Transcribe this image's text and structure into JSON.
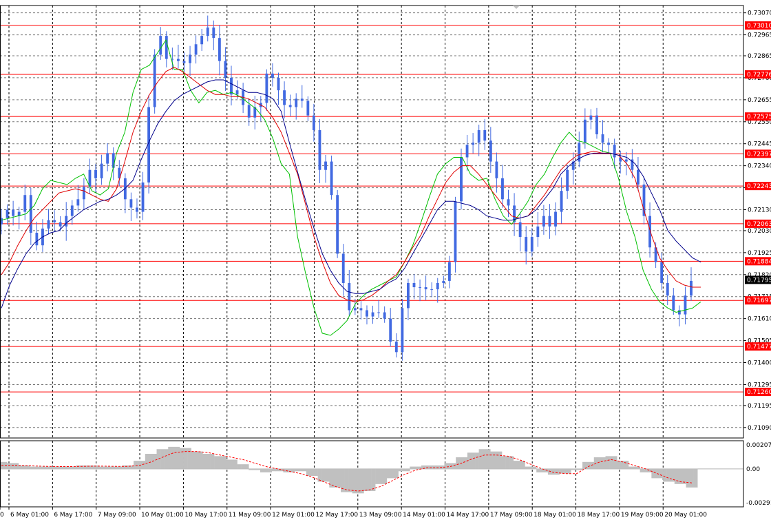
{
  "chart_data": {
    "type": "candlestick",
    "y_axis": {
      "range": [
        0.7104,
        0.73105
      ],
      "tick_labels": [
        "0.73070",
        "0.72965",
        "0.72865",
        "0.72760",
        "0.72655",
        "0.72550",
        "0.72445",
        "0.72340",
        "0.72235",
        "0.72130",
        "0.72030",
        "0.71925",
        "0.71820",
        "0.71715",
        "0.71610",
        "0.71505",
        "0.71400",
        "0.71295",
        "0.71195",
        "0.71090"
      ]
    },
    "x_axis": {
      "tick_labels": [
        "0",
        "6 May 01:00",
        "6 May 17:00",
        "7 May 09:00",
        "10 May 01:00",
        "10 May 17:00",
        "11 May 09:00",
        "12 May 01:00",
        "12 May 17:00",
        "13 May 09:00",
        "14 May 01:00",
        "14 May 17:00",
        "17 May 09:00",
        "18 May 01:00",
        "18 May 17:00",
        "19 May 09:00",
        "20 May 01:00"
      ]
    },
    "grid": true,
    "support_resistance_levels": [
      "0.73010",
      "0.72776",
      "0.72575",
      "0.72397",
      "0.72243",
      "0.72063",
      "0.71884",
      "0.71697",
      "0.71477",
      "0.71260"
    ],
    "current_price": "0.71795",
    "price_closes": [
      0.7209,
      0.7213,
      0.721,
      0.7212,
      0.722,
      0.7202,
      0.7196,
      0.7204,
      0.7208,
      0.7207,
      0.7205,
      0.721,
      0.7215,
      0.7218,
      0.7224,
      0.7232,
      0.7228,
      0.7235,
      0.724,
      0.7233,
      0.7228,
      0.7218,
      0.7214,
      0.7212,
      0.7226,
      0.7262,
      0.7287,
      0.7296,
      0.7285,
      0.7285,
      0.7284,
      0.7283,
      0.7287,
      0.7292,
      0.7296,
      0.73,
      0.7295,
      0.7284,
      0.7276,
      0.7268,
      0.727,
      0.7263,
      0.7257,
      0.7262,
      0.7264,
      0.7278,
      0.7276,
      0.727,
      0.7263,
      0.7262,
      0.7266,
      0.7265,
      0.7258,
      0.7251,
      0.7232,
      0.7236,
      0.722,
      0.7192,
      0.7178,
      0.7165,
      0.7166,
      0.7165,
      0.7162,
      0.7164,
      0.7164,
      0.7161,
      0.715,
      0.7145,
      0.7166,
      0.7178,
      0.7176,
      0.7176,
      0.7175,
      0.7175,
      0.7178,
      0.7179,
      0.7188,
      0.7217,
      0.7238,
      0.7244,
      0.7245,
      0.7251,
      0.7246,
      0.7236,
      0.7228,
      0.7218,
      0.7215,
      0.7207,
      0.72,
      0.7193,
      0.72,
      0.7205,
      0.721,
      0.7205,
      0.7212,
      0.7222,
      0.7232,
      0.7236,
      0.7245,
      0.7256,
      0.7258,
      0.7249,
      0.7245,
      0.7244,
      0.7238,
      0.7236,
      0.7237,
      0.7232,
      0.7225,
      0.721,
      0.7195,
      0.7188,
      0.7178,
      0.7172,
      0.7165,
      0.7163,
      0.7172,
      0.7179
    ],
    "series": [
      {
        "color": "#00c000",
        "values": [
          0.7208,
          0.7209,
          0.721,
          0.7211,
          0.7215,
          0.7223,
          0.7227,
          0.7226,
          0.7225,
          0.7228,
          0.723,
          0.7222,
          0.722,
          0.7223,
          0.724,
          0.725,
          0.7269,
          0.728,
          0.7282,
          0.7288,
          0.7294,
          0.728,
          0.728,
          0.727,
          0.7264,
          0.7269,
          0.727,
          0.7268,
          0.7269,
          0.7267,
          0.7264,
          0.7261,
          0.7256,
          0.7247,
          0.7235,
          0.723,
          0.72,
          0.7182,
          0.7166,
          0.7154,
          0.7153,
          0.7156,
          0.716,
          0.7168,
          0.7172,
          0.7175,
          0.7177,
          0.7179,
          0.7181,
          0.7188,
          0.7196,
          0.7207,
          0.7219,
          0.723,
          0.7235,
          0.7238,
          0.7238,
          0.723,
          0.7227,
          0.7228,
          0.7218,
          0.721,
          0.7206,
          0.7211,
          0.7217,
          0.7225,
          0.723,
          0.7238,
          0.7245,
          0.725,
          0.7246,
          0.7245,
          0.7243,
          0.7241,
          0.724,
          0.7228,
          0.7212,
          0.72,
          0.7184,
          0.7175,
          0.7169,
          0.7166,
          0.7164,
          0.7165,
          0.7166,
          0.7169
        ]
      },
      {
        "color": "#e00000",
        "values": [
          0.7182,
          0.7188,
          0.7196,
          0.7203,
          0.7209,
          0.7213,
          0.7217,
          0.7221,
          0.7222,
          0.7223,
          0.7222,
          0.722,
          0.7218,
          0.7217,
          0.7223,
          0.7236,
          0.725,
          0.726,
          0.7268,
          0.7274,
          0.7279,
          0.7281,
          0.7279,
          0.7276,
          0.7273,
          0.727,
          0.7268,
          0.7268,
          0.7267,
          0.7267,
          0.7266,
          0.7264,
          0.7262,
          0.7257,
          0.725,
          0.724,
          0.723,
          0.7215,
          0.72,
          0.7188,
          0.7178,
          0.7172,
          0.717,
          0.7169,
          0.717,
          0.7172,
          0.7175,
          0.7179,
          0.7182,
          0.7188,
          0.7195,
          0.7201,
          0.721,
          0.7218,
          0.7226,
          0.7231,
          0.7234,
          0.7234,
          0.723,
          0.7225,
          0.722,
          0.7215,
          0.721,
          0.7209,
          0.721,
          0.7215,
          0.722,
          0.7226,
          0.7232,
          0.7236,
          0.7239,
          0.724,
          0.7241,
          0.724,
          0.724,
          0.7239,
          0.7235,
          0.7228,
          0.7214,
          0.7201,
          0.719,
          0.7184,
          0.7179,
          0.7177,
          0.7176,
          0.7176
        ]
      },
      {
        "color": "#00008b",
        "values": [
          0.7166,
          0.7177,
          0.7185,
          0.7192,
          0.7197,
          0.72,
          0.7202,
          0.7203,
          0.7207,
          0.721,
          0.7213,
          0.7215,
          0.7217,
          0.7218,
          0.722,
          0.7223,
          0.7227,
          0.7237,
          0.7246,
          0.7254,
          0.726,
          0.7265,
          0.7268,
          0.727,
          0.7272,
          0.7274,
          0.7275,
          0.7275,
          0.7273,
          0.7271,
          0.7269,
          0.7269,
          0.7268,
          0.7266,
          0.726,
          0.7245,
          0.7231,
          0.7217,
          0.7204,
          0.7192,
          0.7184,
          0.7178,
          0.7174,
          0.7173,
          0.7173,
          0.7174,
          0.7175,
          0.7178,
          0.718,
          0.7185,
          0.7192,
          0.7199,
          0.7206,
          0.7213,
          0.7217,
          0.7217,
          0.7216,
          0.7215,
          0.7213,
          0.721,
          0.7209,
          0.7208,
          0.7208,
          0.7209,
          0.721,
          0.7213,
          0.7218,
          0.7223,
          0.723,
          0.7234,
          0.7237,
          0.7239,
          0.724,
          0.724,
          0.724,
          0.7239,
          0.7238,
          0.7235,
          0.7229,
          0.7221,
          0.7213,
          0.7203,
          0.7198,
          0.7194,
          0.719,
          0.7188
        ]
      }
    ],
    "oscillator": {
      "tick_labels": [
        "0.00207",
        "0.00",
        "-0.00291"
      ],
      "range": [
        -0.00291,
        0.00207
      ],
      "histogram": [
        0.0006,
        0.0005,
        0.0003,
        0.0002,
        0.0002,
        0.0002,
        0.0002,
        0.0003,
        0.0003,
        0.0002,
        0.0002,
        0.0003,
        0.0007,
        0.0013,
        0.0017,
        0.0019,
        0.0018,
        0.0015,
        0.0013,
        0.0011,
        0.0008,
        0.0004,
        -0.0001,
        -0.0003,
        -0.0002,
        -0.0003,
        -0.0002,
        -0.0006,
        -0.0011,
        -0.0016,
        -0.002,
        -0.0021,
        -0.0019,
        -0.0013,
        -0.0008,
        -0.0002,
        0.0002,
        0.0003,
        0.0003,
        0.0005,
        0.001,
        0.0014,
        0.0017,
        0.0015,
        0.0011,
        0.0007,
        0.0002,
        -0.0003,
        -0.0005,
        -0.0004,
        -0.0001,
        0.0006,
        0.001,
        0.0011,
        0.0007,
        0.0002,
        -0.0003,
        -0.0008,
        -0.0011,
        -0.0013,
        -0.0016
      ],
      "signal": [
        0.0003,
        0.00032,
        0.0003,
        0.00025,
        0.00022,
        0.0002,
        0.0002,
        0.00022,
        0.00024,
        0.00024,
        0.00022,
        0.00022,
        0.0003,
        0.0006,
        0.001,
        0.0014,
        0.0015,
        0.0015,
        0.0014,
        0.0012,
        0.001,
        0.0008,
        0.0005,
        0.0002,
        0.0,
        -0.0002,
        -0.0004,
        -0.0007,
        -0.0011,
        -0.0015,
        -0.0018,
        -0.0019,
        -0.0018,
        -0.0015,
        -0.001,
        -0.0005,
        -0.0001,
        0.0001,
        0.0001,
        0.0002,
        0.0005,
        0.0009,
        0.0012,
        0.0012,
        0.0011,
        0.0008,
        0.0004,
        0.0,
        -0.0003,
        -0.0004,
        -0.0004,
        0.0002,
        0.0006,
        0.0008,
        0.0006,
        0.0003,
        0.0,
        -0.0004,
        -0.0008,
        -0.0011,
        -0.0012
      ]
    }
  },
  "colors": {
    "candle": "#4169e1",
    "grid": "#000000",
    "level_line": "#ff0000",
    "level_label_bg": "#ff0000",
    "current_label_bg": "#000000",
    "oscillator_hist": "#c0c0c0",
    "oscillator_signal": "#ff0000"
  }
}
